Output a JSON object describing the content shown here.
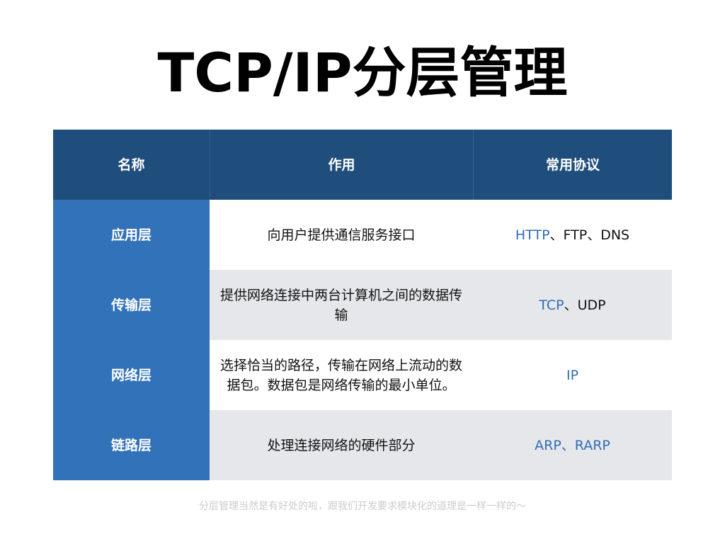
{
  "slide": {
    "title": "TCP/IP分层管理",
    "footnote": "分层管理当然是有好处的啦，跟我们开发要求模块化的道理是一样一样的～"
  },
  "table": {
    "headers": [
      "名称",
      "作用",
      "常用协议"
    ],
    "rows": [
      {
        "name": "应用层",
        "role": "向用户提供通信服务接口",
        "protocol_blue": "HTTP",
        "protocol_rest": "、FTP、DNS"
      },
      {
        "name": "传输层",
        "role": "提供网络连接中两台计算机之间的数据传输",
        "protocol_blue": "TCP",
        "protocol_rest": "、UDP"
      },
      {
        "name": "网络层",
        "role": "选择恰当的路径，传输在网络上流动的数据包。数据包是网络传输的最小单位。",
        "protocol_blue": "IP",
        "protocol_rest": ""
      },
      {
        "name": "链路层",
        "role": "处理连接网络的硬件部分",
        "protocol_blue": "ARP、RARP",
        "protocol_rest": ""
      }
    ]
  },
  "colors": {
    "header_bg": "#1f4e7d",
    "name_col_bg": "#3272b8",
    "stripe_bg": "#e6e7ea",
    "protocol_accent": "#2f6db5",
    "footnote_text": "#cccccc"
  }
}
